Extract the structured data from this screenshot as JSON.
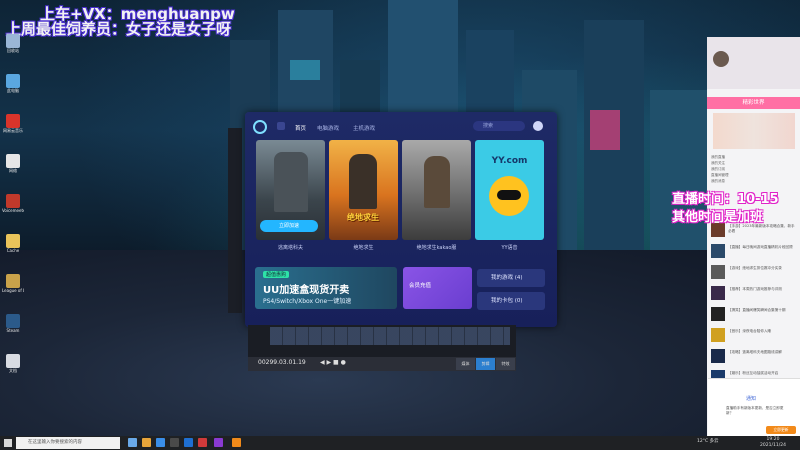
{
  "overlay": {
    "line1": "上车+VX：menghuanpw",
    "line2": "上周最佳饲养员：女子还是女子呀"
  },
  "stream_info": {
    "line1": "直播时间：10-15",
    "line2": "其他时间是加班"
  },
  "app": {
    "nav": [
      "首页",
      "电脑游戏",
      "主机游戏"
    ],
    "search_placeholder": "搜索",
    "cards": [
      {
        "caption": "逃离塔科夫",
        "overlay": "立即加速"
      },
      {
        "caption": "绝地求生",
        "overlay": "绝地求生"
      },
      {
        "caption": "绝地求生kakao服",
        "overlay": ""
      },
      {
        "caption": "YY语音",
        "overlay": "YY.com"
      }
    ],
    "banner": {
      "tag": "超值惠购",
      "title": "UU加速盒现货开卖",
      "subtitle": "PS4/Switch/Xbox One一键加速"
    },
    "member": "会员充值",
    "side_buttons": [
      "我的游戏 (4)",
      "我的卡包 (0)"
    ]
  },
  "editor": {
    "timecode": "00299.03.01.19",
    "tabs": [
      "媒体",
      "剪辑",
      "特效"
    ]
  },
  "panel": {
    "pink_bar": "精彩世界",
    "live_box": {
      "header": "通知",
      "body": "直播助手有新版本更新，是否立即更新？",
      "button": "立即更新"
    },
    "list": [
      "我的直播",
      "我的关注",
      "我的订阅",
      "直播间管理",
      "我的消息"
    ],
    "chat_items": [
      "【手游】2023年最新版本攻略合集，新手必看",
      "【直播】每日晚间游戏直播精彩片段回顾",
      "【游戏】绝地求生排位赛冲分实录",
      "【推荐】本周热门游戏推荐与评测",
      "【搞笑】直播间爆笑瞬间合集第十期",
      "【音乐】深夜电台陪你入睡",
      "【攻略】逃离塔科夫地图路线讲解",
      "【娱乐】粉丝互动抽奖活动开启",
      "【赛事】周末电竞赛事全程回放",
      "【日常】主播日常生活Vlog更新"
    ]
  },
  "desktop_icons": [
    "回收站",
    "此电脑",
    "网易云音乐",
    "网络",
    "Voicemeeter",
    "Cache",
    "League of Legends",
    "Steam",
    "文档"
  ],
  "taskbar": {
    "search_placeholder": "在这里输入你要搜索的内容",
    "tray": "12°C 多云",
    "time": "19:20",
    "date": "2021/11/24"
  }
}
